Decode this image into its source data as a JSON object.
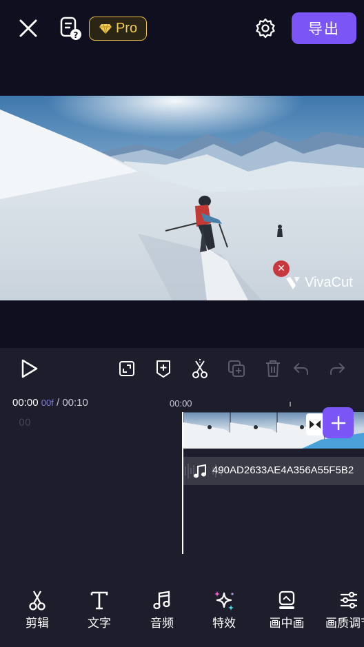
{
  "header": {
    "pro_label": "Pro",
    "export_label": "导出"
  },
  "preview": {
    "watermark_text": "VivaCut"
  },
  "timeline": {
    "current_time": "00:00",
    "current_frame": "00f",
    "separator": "/",
    "total_time": "00:10",
    "ruler_label": "00:00",
    "ghost_label": "00",
    "audio_track_name": "490AD2633AE4A356A55F5B2"
  },
  "bottom_tabs": [
    {
      "label": "剪辑",
      "icon": "scissors-icon"
    },
    {
      "label": "文字",
      "icon": "text-icon"
    },
    {
      "label": "音频",
      "icon": "music-note-icon"
    },
    {
      "label": "特效",
      "icon": "sparkle-effect-icon"
    },
    {
      "label": "画中画",
      "icon": "picture-in-picture-icon"
    },
    {
      "label": "画质调节",
      "icon": "adjust-sliders-icon"
    }
  ],
  "colors": {
    "accent": "#7b55f5",
    "pro_gold": "#f2cc56",
    "background": "#0f0f1f",
    "panel": "#1d1d2c"
  }
}
